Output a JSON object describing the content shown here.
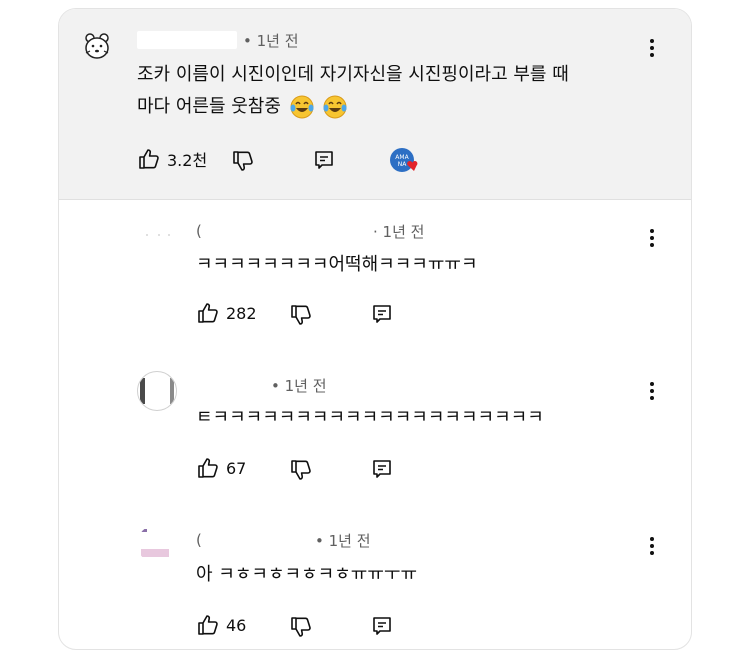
{
  "comment": {
    "time": "• 1년 전",
    "text_line1": "조카 이름이 시진이인데 자기자신을 시진핑이라고 부를 때",
    "text_line2": "마다 어른들 웃참중",
    "emojis": [
      "laughing-tears-emoji",
      "laughing-tears-emoji"
    ],
    "likes": "3.2천"
  },
  "replies": [
    {
      "prefix": "(",
      "time": "· 1년 전",
      "text": "ㅋㅋㅋㅋㅋㅋㅋㅋ어떡해ㅋㅋㅋㅠㅠㅋ",
      "likes": "282"
    },
    {
      "time": "• 1년 전",
      "text": "ㅌㅋㅋㅋㅋㅋㅋㅋㅋㅋㅋㅋㅋㅋㅋㅋㅋㅋㅋㅋㅋ",
      "likes": "67"
    },
    {
      "prefix": "(",
      "time": "• 1년 전",
      "text": "아 ㅋㅎㅋㅎㅋㅎㅋㅎㅠㅠㅜㅠ",
      "likes": "46"
    }
  ],
  "icons": {
    "like": "thumbs-up-icon",
    "dislike": "thumbs-down-icon",
    "reply": "reply-icon",
    "more": "more-vertical-icon",
    "creator_heart": "creator-heart-badge"
  },
  "colors": {
    "top_background": "#f2f2f2",
    "heart": "#e3242b",
    "badge": "#2d6fc4"
  }
}
